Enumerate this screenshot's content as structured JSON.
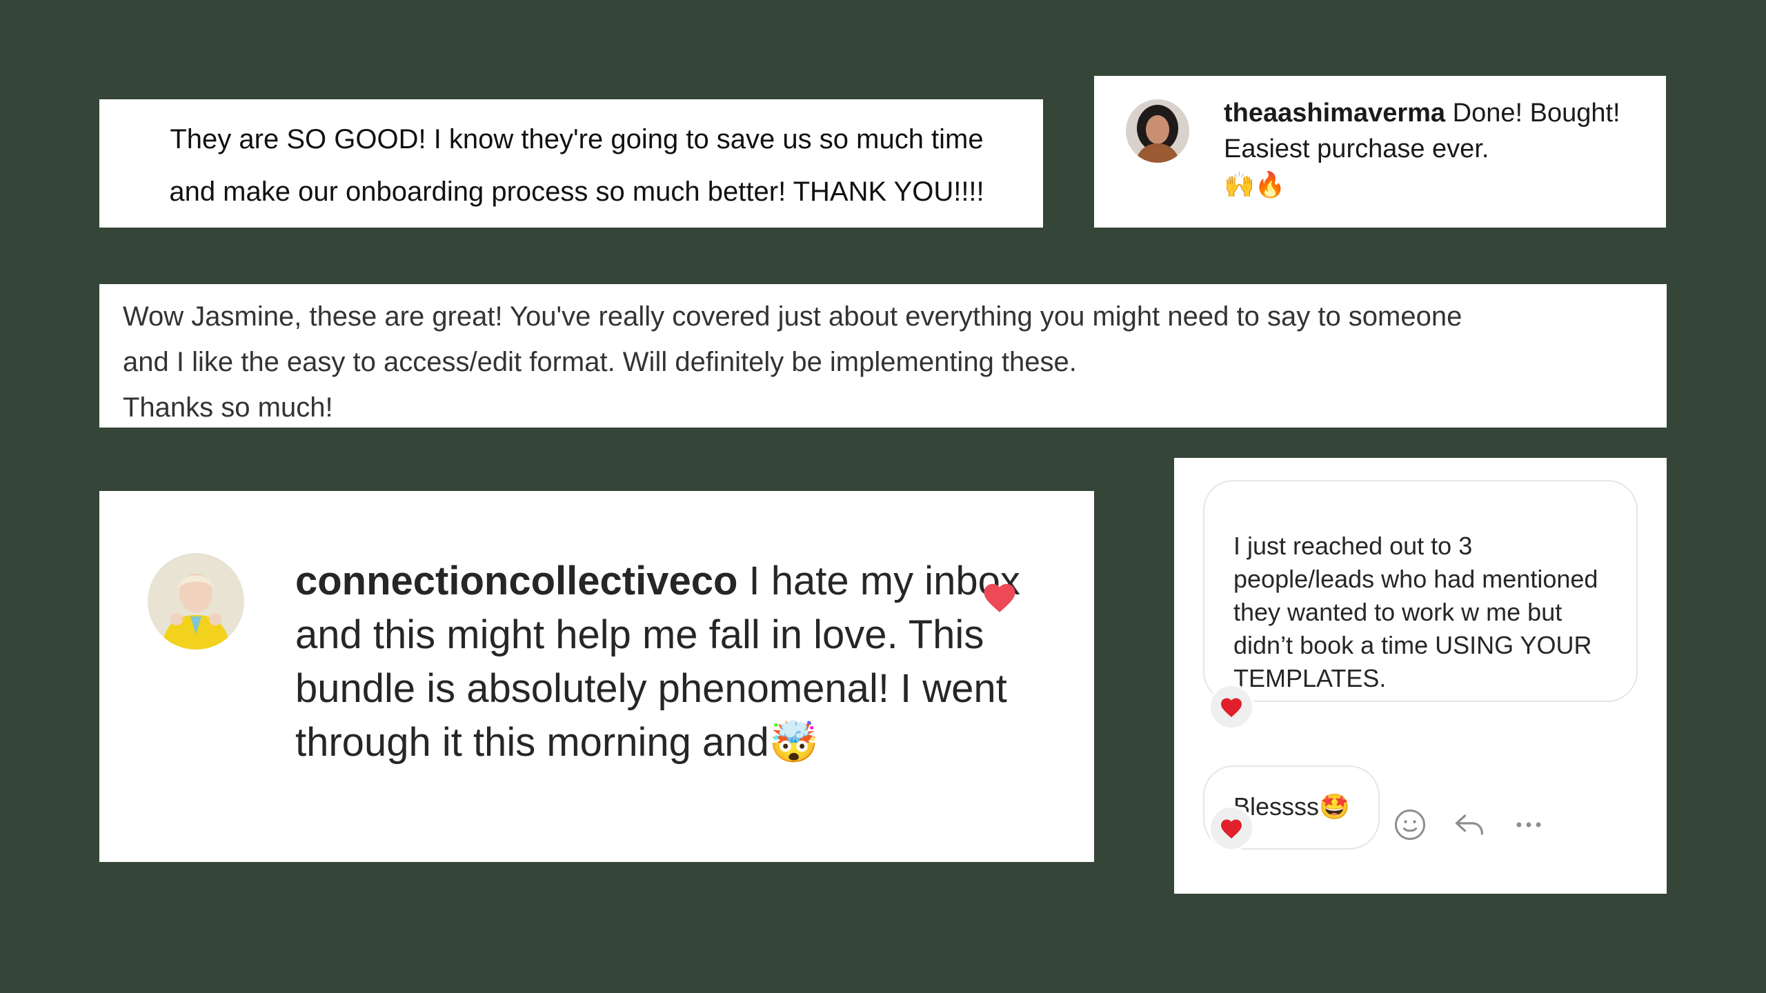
{
  "card1": {
    "line1": "They are SO GOOD! I know they're going to save us so much time",
    "line2": "and make our onboarding process so much better! THANK YOU!!!!"
  },
  "card2": {
    "username": "theaashimaverma",
    "comment": " Done! Bought! Easiest purchase ever.",
    "emojis": "🙌🔥"
  },
  "card3": {
    "line1": "Wow Jasmine, these are great! You've really covered just about everything you might need to say to someone",
    "line2": "and I like the easy to access/edit format. Will definitely be implementing these.",
    "line3": "Thanks so much!"
  },
  "card4": {
    "username": "connectioncollectiveco",
    "comment": " I hate my inbox and this might help me fall in love. This bundle is absolutely phenomenal! I went through it this morning and",
    "emoji": "🤯"
  },
  "card5": {
    "message1": "I just reached out to 3 people/leads who had mentioned they wanted to work w me but didn’t book a time USING YOUR TEMPLATES.",
    "message2": "Blessss",
    "message2_emoji": "🤩"
  },
  "colors": {
    "background": "#354537",
    "heart": "#ED4956",
    "card": "#ffffff"
  },
  "icons": [
    "heart-icon",
    "smile-icon",
    "reply-icon",
    "more-icon"
  ]
}
